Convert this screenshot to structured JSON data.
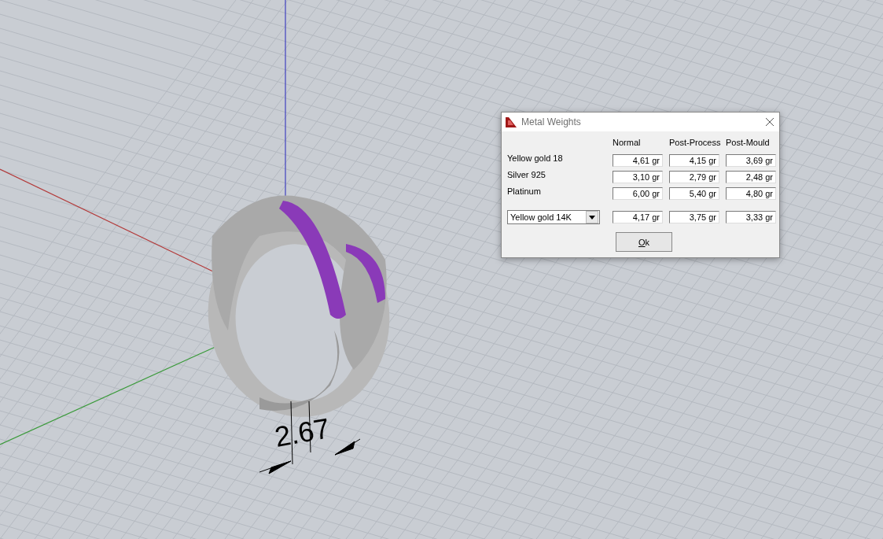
{
  "viewport": {
    "dimension": "2.67"
  },
  "dialog": {
    "title": "Metal Weights",
    "columns": [
      "Normal",
      "Post-Process",
      "Post-Mould"
    ],
    "rows": [
      {
        "label": "Yellow gold 18",
        "values": [
          "4,61 gr",
          "4,15 gr",
          "3,69 gr"
        ]
      },
      {
        "label": "Silver 925",
        "values": [
          "3,10 gr",
          "2,79 gr",
          "2,48 gr"
        ]
      },
      {
        "label": "Platinum",
        "values": [
          "6,00 gr",
          "5,40 gr",
          "4,80 gr"
        ]
      }
    ],
    "custom_row": {
      "alloy": "Yellow gold 14K",
      "values": [
        "4,17 gr",
        "3,75 gr",
        "3,33 gr"
      ]
    },
    "ok_button": "Ok"
  }
}
